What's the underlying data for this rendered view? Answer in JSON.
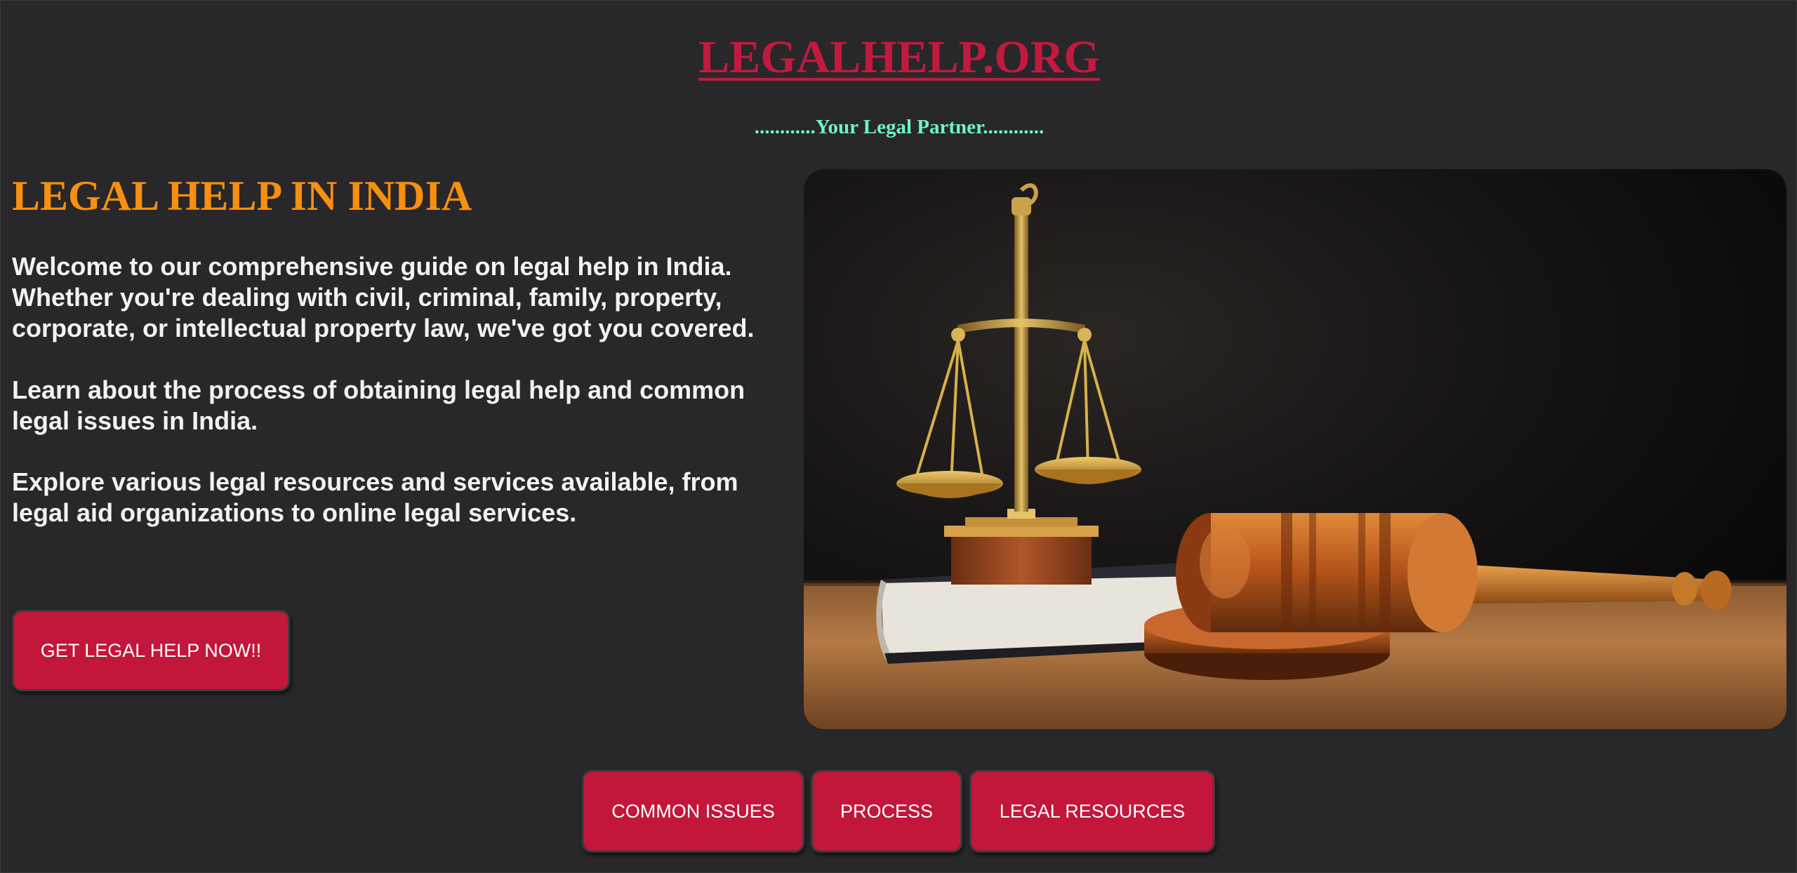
{
  "header": {
    "site_title": "LEGALHELP.ORG",
    "tagline": "............Your Legal Partner............"
  },
  "main": {
    "heading": "LEGAL HELP IN INDIA",
    "paragraphs": [
      "Welcome to our comprehensive guide on legal help in India. Whether you're dealing with civil, criminal, family, property, corporate, or intellectual property law, we've got you covered.",
      "Learn about the process of obtaining legal help and common legal issues in India.",
      "Explore various legal resources and services available, from legal aid organizations to online legal services."
    ],
    "cta_label": "GET LEGAL HELP NOW!!"
  },
  "nav": {
    "items": [
      {
        "label": "COMMON ISSUES"
      },
      {
        "label": "PROCESS"
      },
      {
        "label": "LEGAL RESOURCES"
      }
    ]
  },
  "colors": {
    "background": "#282729",
    "site_title": "#c21a3f",
    "tagline": "#6ff2c8",
    "heading": "#f78f0f",
    "button": "#c3163b"
  }
}
